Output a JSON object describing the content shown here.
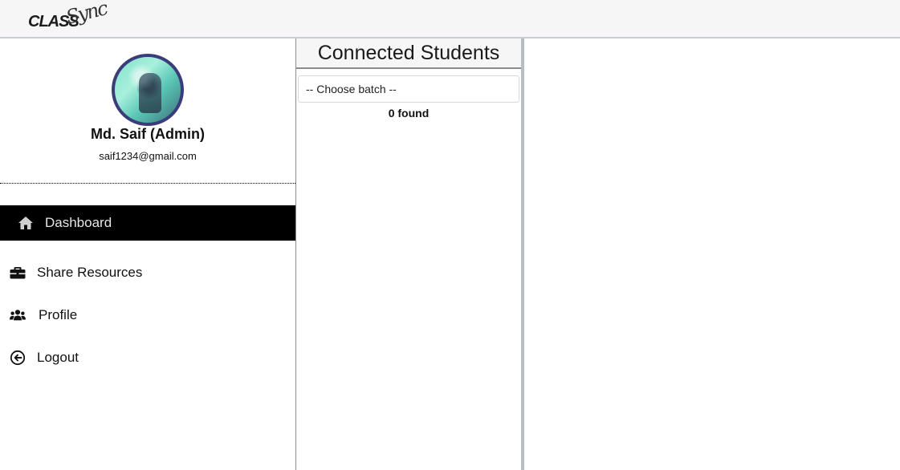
{
  "header": {
    "logo_main": "CLASS",
    "logo_script": "Sync"
  },
  "profile": {
    "name": "Md. Saif (Admin)",
    "email": "saif1234@gmail.com"
  },
  "sidebar": {
    "items": [
      {
        "label": "Dashboard",
        "icon": "home-icon",
        "active": true
      },
      {
        "label": "Share Resources",
        "icon": "briefcase-icon",
        "active": false
      },
      {
        "label": "Profile",
        "icon": "users-icon",
        "active": false
      },
      {
        "label": "Logout",
        "icon": "arrow-circle-left-icon",
        "active": false
      }
    ]
  },
  "students": {
    "title": "Connected Students",
    "batch_select_value": "-- Choose batch --",
    "found_text": "0 found"
  },
  "colors": {
    "active_nav_bg": "#000000",
    "avatar_border": "#3b3d7a",
    "divider": "#b4bec4"
  }
}
